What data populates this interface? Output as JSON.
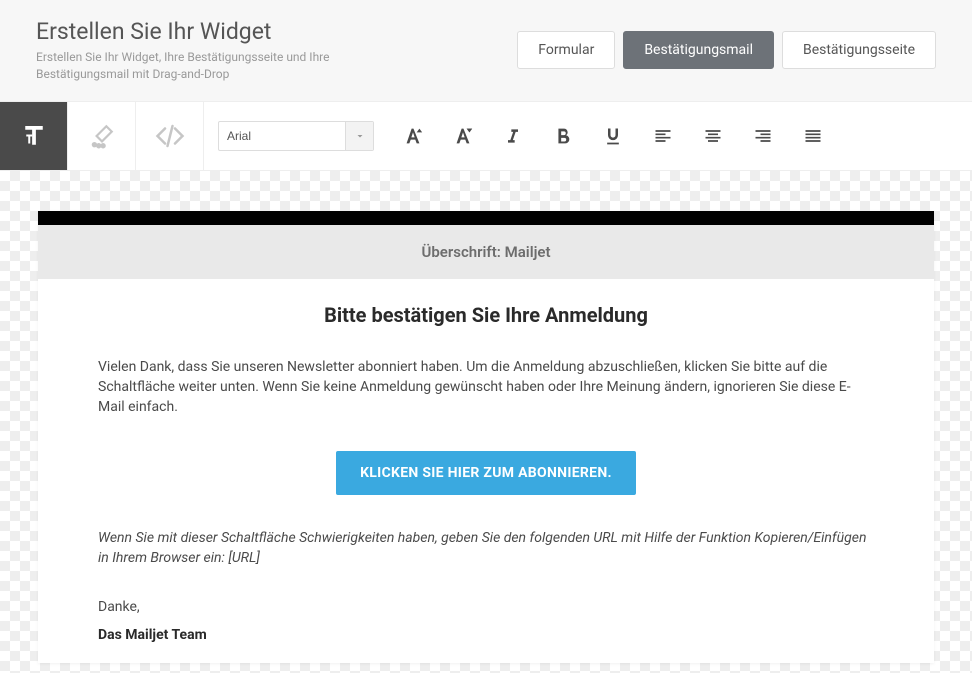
{
  "page": {
    "title": "Erstellen Sie Ihr Widget",
    "subtitle": "Erstellen Sie Ihr Widget, Ihre Bestätigungsseite und Ihre Bestätigungsmail mit Drag-and-Drop"
  },
  "tabs": [
    {
      "label": "Formular",
      "active": false
    },
    {
      "label": "Bestätigungsmail",
      "active": true
    },
    {
      "label": "Bestätigungsseite",
      "active": false
    }
  ],
  "sideTools": [
    {
      "name": "text-tool",
      "active": true
    },
    {
      "name": "style-tool",
      "active": false
    },
    {
      "name": "code-tool",
      "active": false
    }
  ],
  "toolbar": {
    "font": "Arial",
    "buttons": {
      "sizeUp": "Increase font size",
      "sizeDown": "Decrease font size",
      "italic": "Italic",
      "bold": "Bold",
      "underline": "Underline",
      "alignLeft": "Align left",
      "alignCenter": "Align center",
      "alignRight": "Align right",
      "alignJustify": "Justify"
    }
  },
  "email": {
    "headerLabel": "Überschrift: Mailjet",
    "heading": "Bitte bestätigen Sie Ihre Anmeldung",
    "paragraph": "Vielen Dank, dass Sie unseren Newsletter abonniert haben. Um die Anmeldung abzuschließen, klicken Sie bitte auf die Schaltfläche weiter unten. Wenn Sie keine Anmeldung gewünscht haben oder Ihre Meinung ändern, ignorieren Sie diese E-Mail einfach.",
    "ctaLabel": "KLICKEN SIE HIER ZUM ABONNIEREN.",
    "fallback": "Wenn Sie mit dieser Schaltfläche Schwierigkeiten haben, geben Sie den folgenden URL mit Hilfe der Funktion Kopieren/Einfügen in Ihrem Browser ein: [URL]",
    "thanks": "Danke,",
    "signature": "Das Mailjet Team"
  }
}
